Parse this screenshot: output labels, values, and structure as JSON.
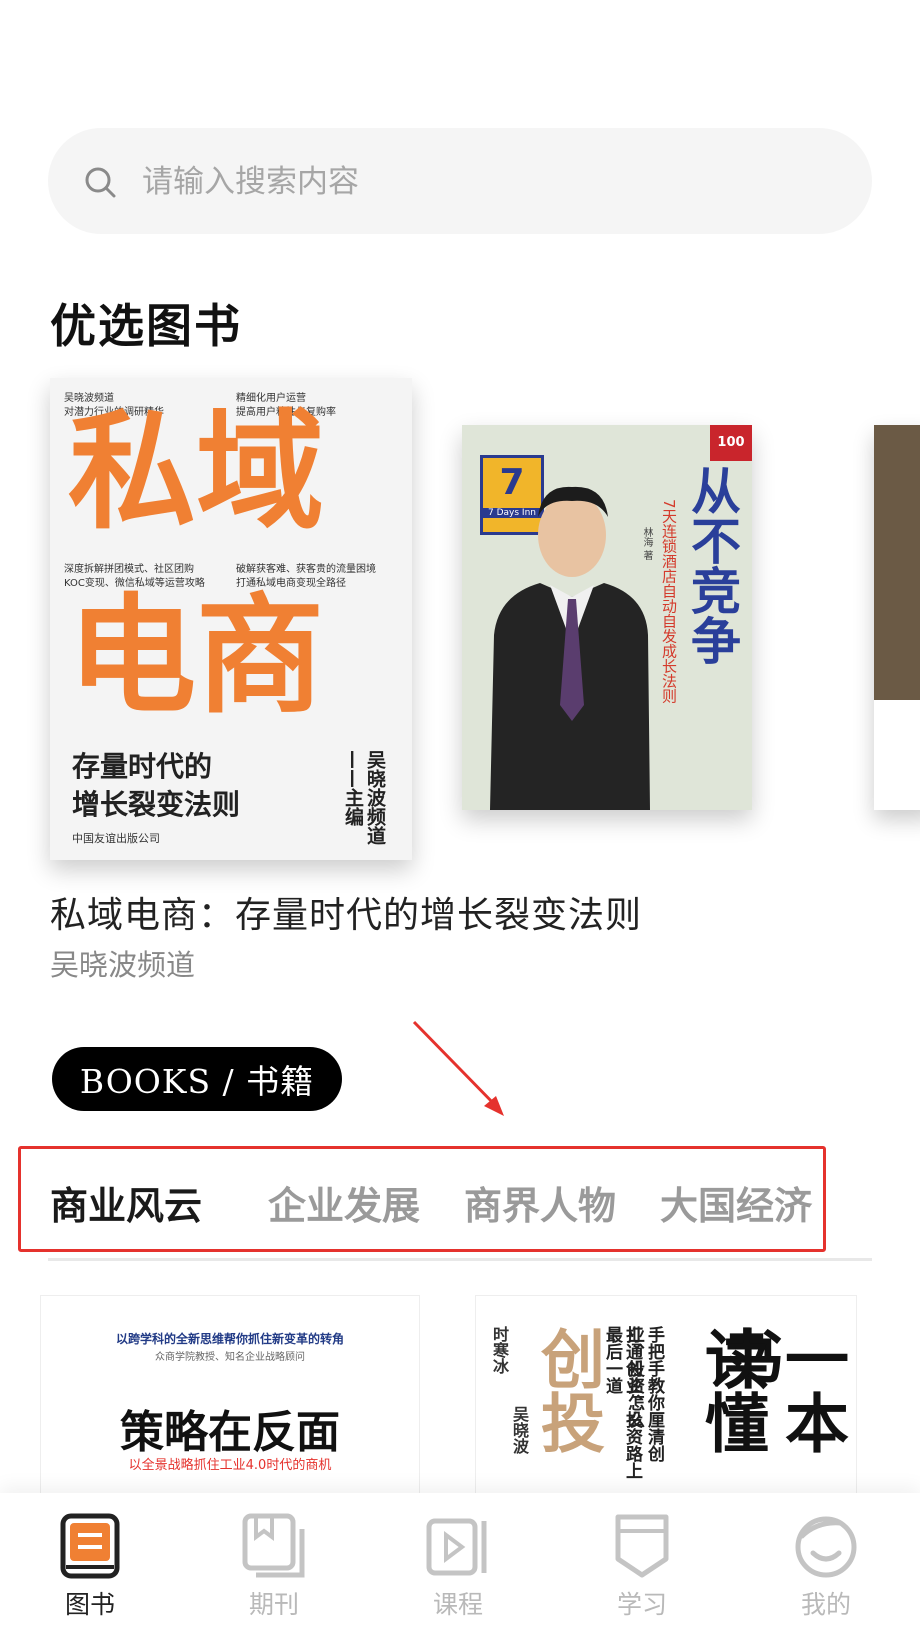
{
  "search": {
    "placeholder": "请输入搜索内容"
  },
  "featured": {
    "section_title": "优选图书",
    "book1": {
      "tag_left_1": "吴晓波频道",
      "tag_left_2": "对潜力行业的调研精华",
      "tag_right_1": "精细化用户运营",
      "tag_right_2": "提高用户粘性与复购率",
      "big_line_1": "私域",
      "big_line_2": "电商",
      "mid_left_1": "深度拆解拼团模式、社区团购",
      "mid_left_2": "KOC变现、微信私域等运营攻略",
      "mid_right_1": "破解获客难、获客贵的流量困境",
      "mid_right_2": "打通私域电商变现全路径",
      "sub_1": "存量时代的",
      "sub_2": "增长裂变法则",
      "editor": "吴晓波频道——主编",
      "publisher": "中国友谊出版公司"
    },
    "book2": {
      "badge": "100",
      "logo_num": "7",
      "logo_text": "7 Days Inn",
      "title": "从不竞争",
      "subtitle": "7天连锁酒店自动自发成长法则",
      "author": "林海 著"
    },
    "current_title": "私域电商：存量时代的增长裂变法则",
    "current_author": "吴晓波频道"
  },
  "books_pill": "BOOKS / 书籍",
  "tabs": [
    {
      "label": "商业风云",
      "active": true
    },
    {
      "label": "企业发展",
      "active": false
    },
    {
      "label": "商界人物",
      "active": false
    },
    {
      "label": "大国经济",
      "active": false
    }
  ],
  "grid": {
    "book1": {
      "top": "以跨学科的全新思维帮你抓住新变革的转角",
      "top2": "众商学院教授、知名企业战略顾问",
      "title": "策略在反面",
      "subtitle": "以全景战略抓住工业4.0时代的商机"
    },
    "book2": {
      "c1": "一本书",
      "c2": "读懂",
      "c3": "创投",
      "c4": "手把手教你厘清创业、投资怎么",
      "c5": "打通创业、投资路上最后一道",
      "author1": "时寒冰",
      "author2": "吴晓波"
    }
  },
  "bottom_nav": [
    {
      "label": "图书",
      "icon": "book-icon",
      "active": true
    },
    {
      "label": "期刊",
      "icon": "journal-icon",
      "active": false
    },
    {
      "label": "课程",
      "icon": "course-icon",
      "active": false
    },
    {
      "label": "学习",
      "icon": "study-icon",
      "active": false
    },
    {
      "label": "我的",
      "icon": "profile-icon",
      "active": false
    }
  ],
  "colors": {
    "accent": "#f08033",
    "annotation": "#e5322d",
    "inactive": "#b9b9b9"
  }
}
